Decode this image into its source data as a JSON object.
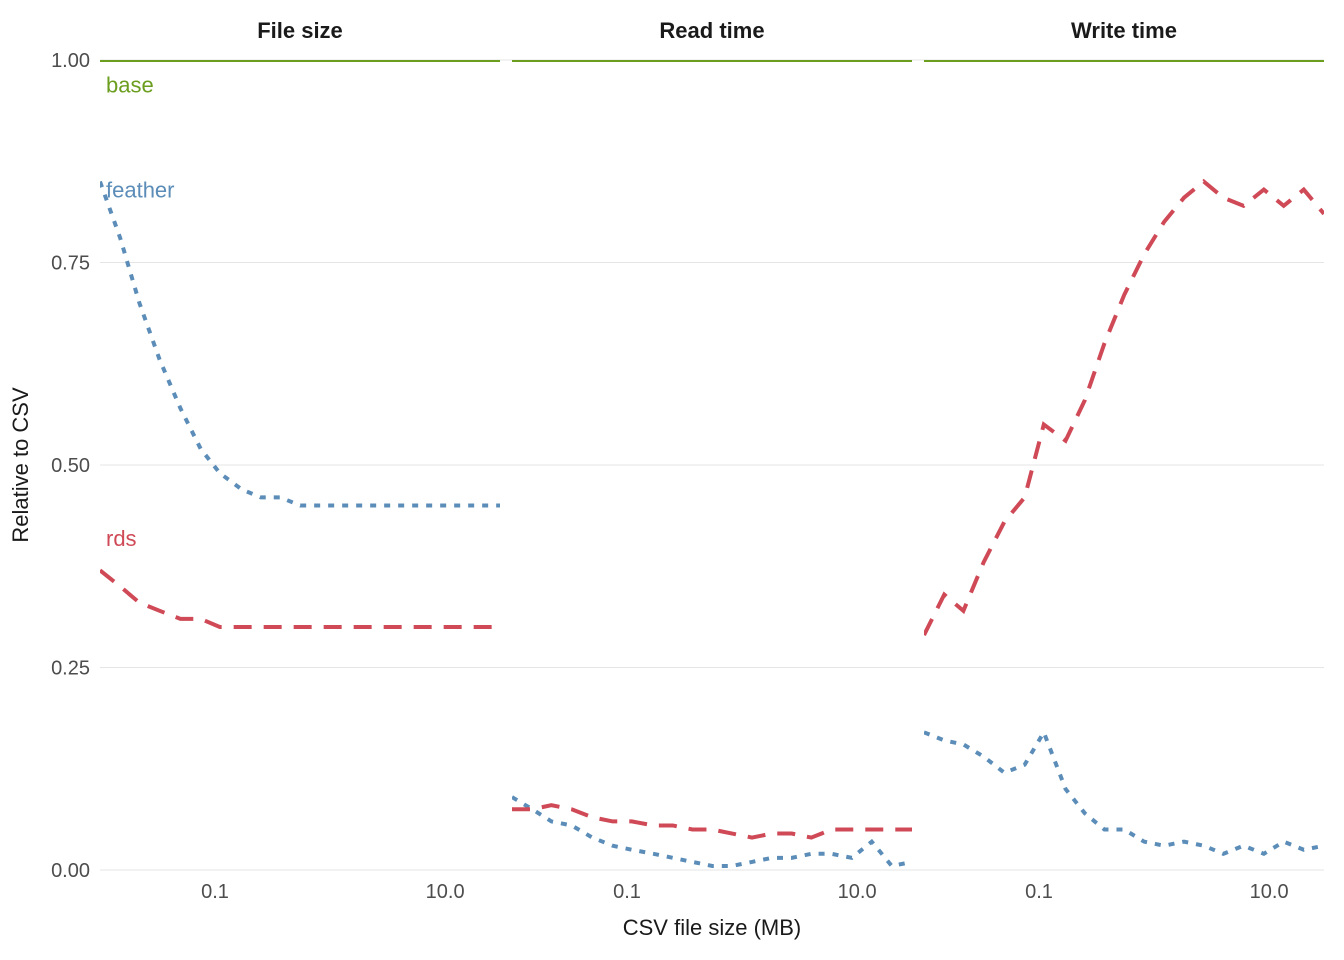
{
  "chart_data": {
    "type": "line",
    "xlabel": "CSV file size (MB)",
    "ylabel": "Relative to CSV",
    "ylim": [
      0.0,
      1.0
    ],
    "yticks": [
      0.0,
      0.25,
      0.5,
      0.75,
      1.0
    ],
    "ytick_labels": [
      "0.00",
      "0.25",
      "0.50",
      "0.75",
      "1.00"
    ],
    "x_scale": "log",
    "xlim": [
      0.01,
      30
    ],
    "xticks": [
      0.1,
      10.0
    ],
    "xtick_labels": [
      "0.1",
      "10.0"
    ],
    "x": [
      0.01,
      0.015,
      0.022,
      0.033,
      0.05,
      0.075,
      0.11,
      0.17,
      0.25,
      0.37,
      0.55,
      0.82,
      1.22,
      1.82,
      2.7,
      4.0,
      6.0,
      9.0,
      13.4,
      20.0,
      30.0
    ],
    "facets": [
      {
        "title": "File size",
        "series": {
          "base": [
            1.0,
            1.0,
            1.0,
            1.0,
            1.0,
            1.0,
            1.0,
            1.0,
            1.0,
            1.0,
            1.0,
            1.0,
            1.0,
            1.0,
            1.0,
            1.0,
            1.0,
            1.0,
            1.0,
            1.0,
            1.0
          ],
          "feather": [
            0.85,
            0.78,
            0.7,
            0.63,
            0.57,
            0.52,
            0.49,
            0.47,
            0.46,
            0.46,
            0.45,
            0.45,
            0.45,
            0.45,
            0.45,
            0.45,
            0.45,
            0.45,
            0.45,
            0.45,
            0.45
          ],
          "rds": [
            0.37,
            0.35,
            0.33,
            0.32,
            0.31,
            0.31,
            0.3,
            0.3,
            0.3,
            0.3,
            0.3,
            0.3,
            0.3,
            0.3,
            0.3,
            0.3,
            0.3,
            0.3,
            0.3,
            0.3,
            0.3
          ]
        },
        "annotations": [
          {
            "series": "base",
            "text": "base",
            "y": 0.97
          },
          {
            "series": "feather",
            "text": "feather",
            "y": 0.84
          },
          {
            "series": "rds",
            "text": "rds",
            "y": 0.41
          }
        ]
      },
      {
        "title": "Read time",
        "series": {
          "base": [
            1.0,
            1.0,
            1.0,
            1.0,
            1.0,
            1.0,
            1.0,
            1.0,
            1.0,
            1.0,
            1.0,
            1.0,
            1.0,
            1.0,
            1.0,
            1.0,
            1.0,
            1.0,
            1.0,
            1.0,
            1.0
          ],
          "feather": [
            0.09,
            0.075,
            0.06,
            0.055,
            0.04,
            0.03,
            0.025,
            0.02,
            0.015,
            0.01,
            0.005,
            0.005,
            0.01,
            0.015,
            0.015,
            0.02,
            0.02,
            0.015,
            0.035,
            0.005,
            0.01
          ],
          "rds": [
            0.075,
            0.075,
            0.08,
            0.075,
            0.065,
            0.06,
            0.06,
            0.055,
            0.055,
            0.05,
            0.05,
            0.045,
            0.04,
            0.045,
            0.045,
            0.04,
            0.05,
            0.05,
            0.05,
            0.05,
            0.05
          ]
        },
        "annotations": []
      },
      {
        "title": "Write time",
        "series": {
          "base": [
            1.0,
            1.0,
            1.0,
            1.0,
            1.0,
            1.0,
            1.0,
            1.0,
            1.0,
            1.0,
            1.0,
            1.0,
            1.0,
            1.0,
            1.0,
            1.0,
            1.0,
            1.0,
            1.0,
            1.0,
            1.0
          ],
          "feather": [
            0.17,
            0.16,
            0.155,
            0.14,
            0.12,
            0.13,
            0.17,
            0.1,
            0.07,
            0.05,
            0.05,
            0.035,
            0.03,
            0.035,
            0.03,
            0.02,
            0.03,
            0.02,
            0.035,
            0.025,
            0.03
          ],
          "rds": [
            0.29,
            0.34,
            0.32,
            0.38,
            0.43,
            0.46,
            0.55,
            0.53,
            0.58,
            0.65,
            0.71,
            0.76,
            0.8,
            0.83,
            0.85,
            0.83,
            0.82,
            0.84,
            0.82,
            0.84,
            0.81
          ]
        },
        "annotations": []
      }
    ],
    "colors": {
      "base": "#6b9e1e",
      "feather": "#5b8db8",
      "rds": "#cf4a56"
    }
  }
}
